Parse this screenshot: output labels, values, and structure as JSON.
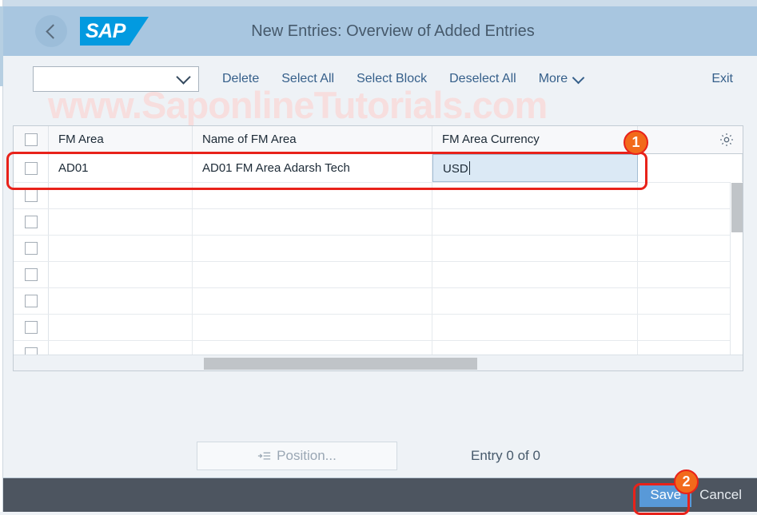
{
  "header": {
    "title": "New Entries: Overview of Added Entries",
    "logo_text": "SAP",
    "back_icon": "chevron-left-icon"
  },
  "toolbar": {
    "variant_select_value": "",
    "variant_select_placeholder": "",
    "buttons": [
      {
        "label": "Delete"
      },
      {
        "label": "Select All"
      },
      {
        "label": "Select Block"
      },
      {
        "label": "Deselect All"
      },
      {
        "label": "More"
      }
    ],
    "exit_label": "Exit",
    "more_icon": "chevron-down-icon",
    "dropdown_icon": "chevron-down-icon"
  },
  "watermark": {
    "text": "www.SaponlineTutorials.com"
  },
  "table": {
    "settings_icon": "gear-icon",
    "value_help_icon": "magnifier-icon",
    "columns": [
      {
        "label": "FM Area"
      },
      {
        "label": "Name of FM Area"
      },
      {
        "label": "FM Area Currency"
      }
    ],
    "rows": [
      {
        "fm_area": "AD01",
        "name_of_fm_area": "AD01 FM Area Adarsh Tech",
        "fm_area_currency": "USD",
        "active": true
      },
      {
        "fm_area": "",
        "name_of_fm_area": "",
        "fm_area_currency": "",
        "active": false
      },
      {
        "fm_area": "",
        "name_of_fm_area": "",
        "fm_area_currency": "",
        "active": false
      },
      {
        "fm_area": "",
        "name_of_fm_area": "",
        "fm_area_currency": "",
        "active": false
      },
      {
        "fm_area": "",
        "name_of_fm_area": "",
        "fm_area_currency": "",
        "active": false
      },
      {
        "fm_area": "",
        "name_of_fm_area": "",
        "fm_area_currency": "",
        "active": false
      },
      {
        "fm_area": "",
        "name_of_fm_area": "",
        "fm_area_currency": "",
        "active": false
      },
      {
        "fm_area": "",
        "name_of_fm_area": "",
        "fm_area_currency": "",
        "active": false
      }
    ]
  },
  "footer": {
    "position_label": "Position...",
    "position_icon": "position-list-icon",
    "entry_status": "Entry 0 of 0",
    "save_label": "Save",
    "cancel_label": "Cancel"
  },
  "annotations": [
    {
      "number": "1"
    },
    {
      "number": "2"
    }
  ],
  "colors": {
    "header_bg": "#a8c6e0",
    "footer_bg": "#4d5560",
    "save_bg": "#5899d8",
    "link": "#355f8a",
    "annotation_ring": "#e8221a",
    "annotation_badge": "#f26a1b",
    "sap_blue": "#029ae0",
    "active_cell": "#dbe9f5"
  }
}
